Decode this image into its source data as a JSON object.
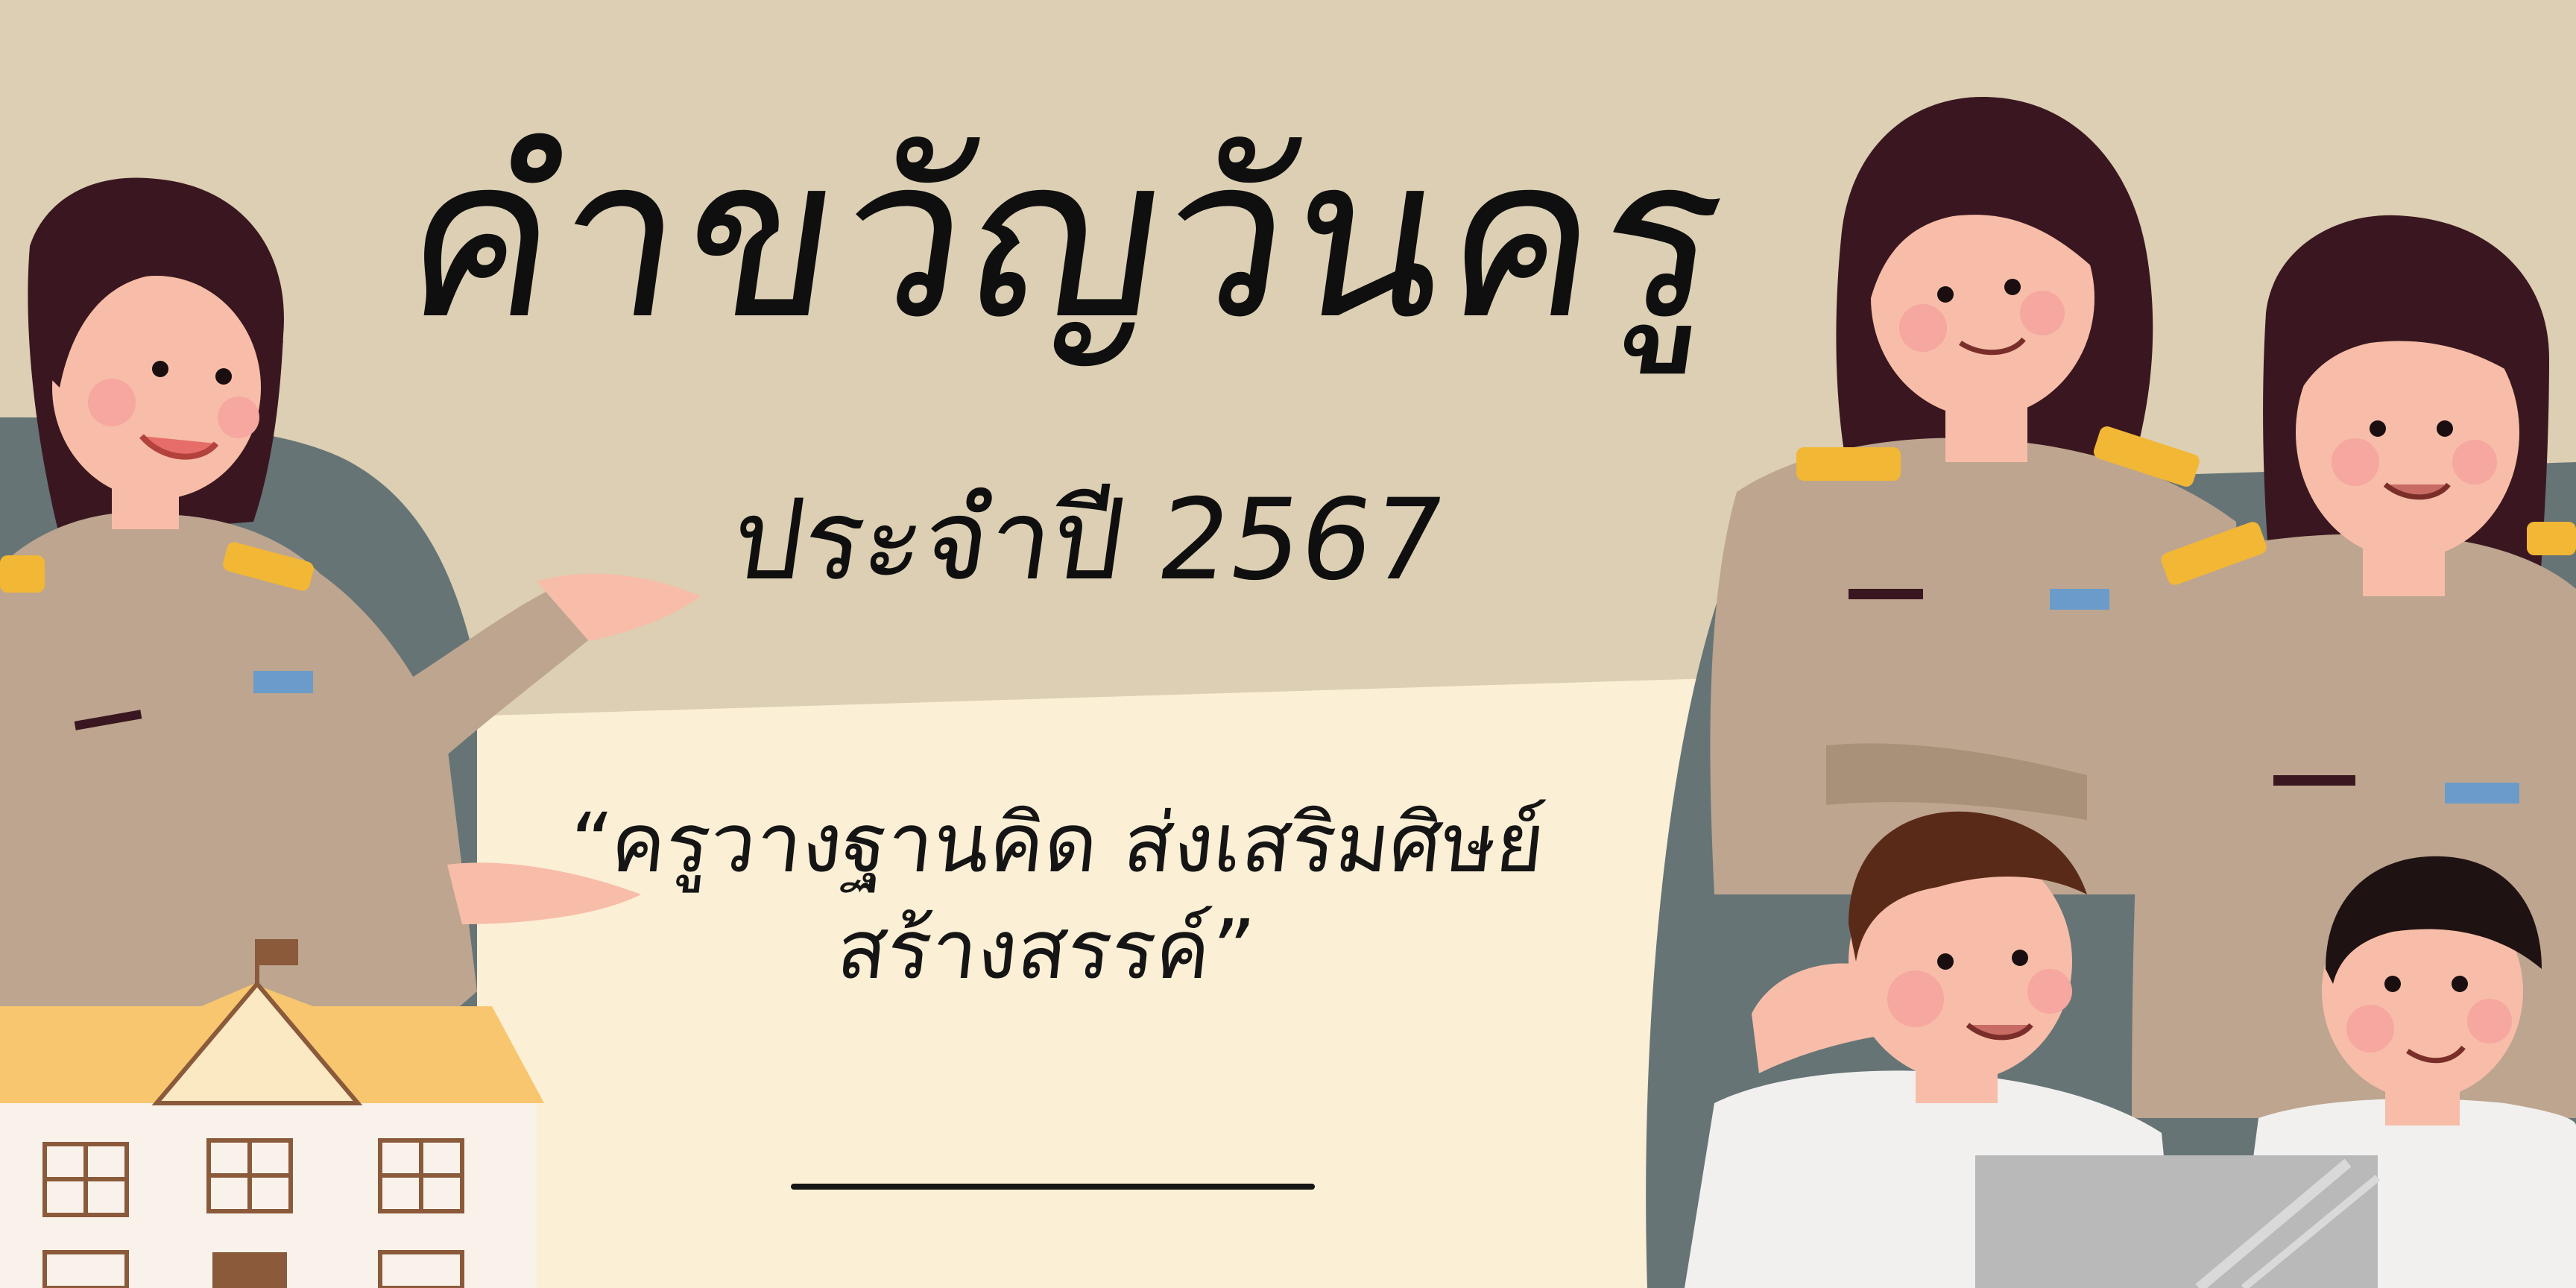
{
  "banner": {
    "title": "คำขวัญวันครู",
    "subtitle": "ประจำปี 2567",
    "motto_line1": "“ครูวางฐานคิด ส่งเสริมศิษย์",
    "motto_line2": "สร้างสรรค์”"
  },
  "colors": {
    "background_top": "#dccfb3",
    "background_bottom": "#fbefd5",
    "text": "#0f0f0f",
    "uniform": "#bda58f",
    "hair": "#3a1720",
    "skin": "#f7bda8",
    "slate": "#667476",
    "school_roof": "#f7c66e"
  }
}
